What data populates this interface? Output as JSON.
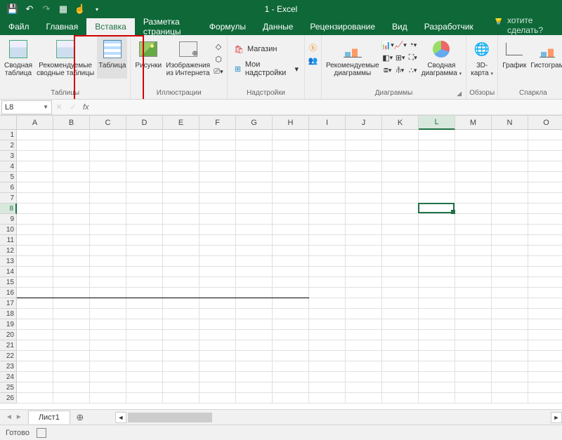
{
  "title": "1 - Excel",
  "tabs": {
    "file": "Файл",
    "home": "Главная",
    "insert": "Вставка",
    "pagelayout": "Разметка страницы",
    "formulas": "Формулы",
    "data": "Данные",
    "review": "Рецензирование",
    "view": "Вид",
    "developer": "Разработчик"
  },
  "tell_me": "Что вы хотите сделать?",
  "ribbon": {
    "tables": {
      "pivot": "Сводная\nтаблица",
      "recpivot": "Рекомендуемые\nсводные таблицы",
      "table": "Таблица",
      "group": "Таблицы"
    },
    "illus": {
      "pictures": "Рисунки",
      "online": "Изображения\nиз Интернета",
      "group": "Иллюстрации"
    },
    "addins": {
      "store": "Магазин",
      "myaddins": "Мои надстройки",
      "group": "Надстройки"
    },
    "charts": {
      "rec": "Рекомендуемые\nдиаграммы",
      "pivotchart": "Сводная\nдиаграмма",
      "group": "Диаграммы"
    },
    "tours": {
      "map": "3D-\nкарта",
      "group": "Обзоры"
    },
    "spark": {
      "line": "График",
      "column": "Гистограм",
      "group": "Спаркла"
    }
  },
  "namebox": "L8",
  "sheet": "Лист1",
  "status": "Готово",
  "cols": [
    "A",
    "B",
    "C",
    "D",
    "E",
    "F",
    "G",
    "H",
    "I",
    "J",
    "K",
    "L",
    "M",
    "N",
    "O"
  ],
  "rowCount": 26,
  "selected": {
    "col": "L",
    "row": 8
  }
}
